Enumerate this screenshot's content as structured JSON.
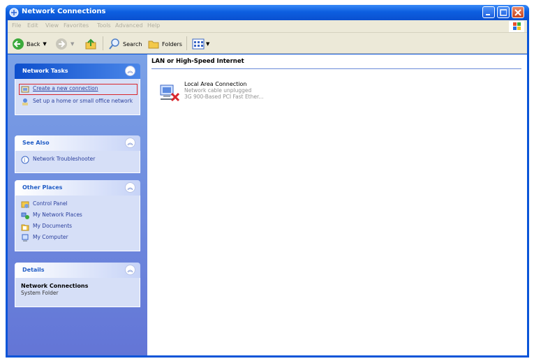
{
  "window": {
    "title": "Network Connections"
  },
  "menu": [
    "File",
    "Edit",
    "View",
    "Favorites",
    "Tools",
    "Advanced",
    "Help"
  ],
  "toolbar": {
    "back": "Back",
    "search": "Search",
    "folders": "Folders"
  },
  "sidebar": {
    "network_tasks": {
      "title": "Network Tasks",
      "items": [
        "Create a new connection",
        "Set up a home or small office network"
      ]
    },
    "see_also": {
      "title": "See Also",
      "items": [
        "Network Troubleshooter"
      ]
    },
    "other_places": {
      "title": "Other Places",
      "items": [
        "Control Panel",
        "My Network Places",
        "My Documents",
        "My Computer"
      ]
    },
    "details": {
      "title": "Details",
      "name": "Network Connections",
      "type": "System Folder"
    }
  },
  "content": {
    "group_header": "LAN or High-Speed Internet",
    "connection": {
      "name": "Local Area Connection",
      "status": "Network cable unplugged",
      "device": "3G 900-Based PCI Fast Ether..."
    }
  },
  "colors": {
    "highlight_box": "#d9262c",
    "title_bar": "#0a55d8",
    "sidebar": "#7ba2e7"
  }
}
